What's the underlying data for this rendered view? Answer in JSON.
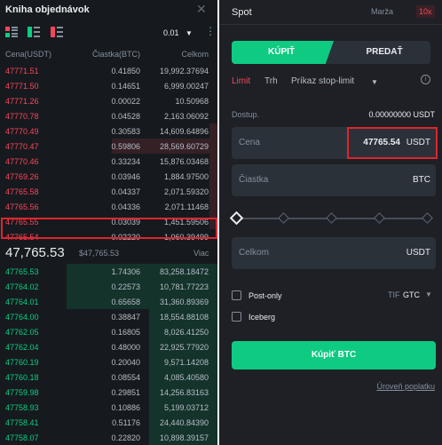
{
  "order_book": {
    "title": "Kniha objednávok",
    "precision": "0.01",
    "columns": {
      "price": "Cena(USDT)",
      "amount": "Čiastka(BTC)",
      "total": "Celkom"
    },
    "asks": [
      {
        "price": "47771.51",
        "amount": "0.41850",
        "total": "19,992.37694",
        "depth": 0
      },
      {
        "price": "47771.50",
        "amount": "0.14651",
        "total": "6,999.00247",
        "depth": 0
      },
      {
        "price": "47771.26",
        "amount": "0.00022",
        "total": "10.50968",
        "depth": 0
      },
      {
        "price": "47770.78",
        "amount": "0.04528",
        "total": "2,163.06092",
        "depth": 0
      },
      {
        "price": "47770.49",
        "amount": "0.30583",
        "total": "14,609.64896",
        "depth": 0.05
      },
      {
        "price": "47770.47",
        "amount": "0.59806",
        "total": "28,569.60729",
        "depth": 0.7
      },
      {
        "price": "47770.46",
        "amount": "0.33234",
        "total": "15,876.03468",
        "depth": 0.05
      },
      {
        "price": "47769.26",
        "amount": "0.03946",
        "total": "1,884.97500",
        "depth": 0.05
      },
      {
        "price": "47765.58",
        "amount": "0.04337",
        "total": "2,071.59320",
        "depth": 0.05
      },
      {
        "price": "47765.56",
        "amount": "0.04336",
        "total": "2,071.11468",
        "depth": 0.05
      },
      {
        "price": "47765.55",
        "amount": "0.03039",
        "total": "1,451.59506",
        "depth": 0.05
      },
      {
        "price": "47765.54",
        "amount": "0.02220",
        "total": "1,060.39499",
        "depth": 0
      }
    ],
    "last_price": "47,765.53",
    "last_price_usd": "$47,765.53",
    "more_label": "Viac",
    "bids": [
      {
        "price": "47765.53",
        "amount": "1.74306",
        "total": "83,258.18472",
        "depth": 1.0
      },
      {
        "price": "47764.02",
        "amount": "0.22573",
        "total": "10,781.77223",
        "depth": 1.0
      },
      {
        "price": "47764.01",
        "amount": "0.65658",
        "total": "31,360.89369",
        "depth": 1.0
      },
      {
        "price": "47764.00",
        "amount": "0.38847",
        "total": "18,554.88108",
        "depth": 0.45
      },
      {
        "price": "47762.05",
        "amount": "0.16805",
        "total": "8,026.41250",
        "depth": 0.45
      },
      {
        "price": "47762.04",
        "amount": "0.48000",
        "total": "22,925.77920",
        "depth": 0.45
      },
      {
        "price": "47760.19",
        "amount": "0.20040",
        "total": "9,571.14208",
        "depth": 0.45
      },
      {
        "price": "47760.18",
        "amount": "0.08554",
        "total": "4,085.40580",
        "depth": 0.45
      },
      {
        "price": "47759.98",
        "amount": "0.29851",
        "total": "14,256.83163",
        "depth": 0.45
      },
      {
        "price": "47758.93",
        "amount": "0.10886",
        "total": "5,199.03712",
        "depth": 0.45
      },
      {
        "price": "47758.41",
        "amount": "0.51176",
        "total": "24,440.84390",
        "depth": 0.45
      },
      {
        "price": "47758.07",
        "amount": "0.22820",
        "total": "10,898.39157",
        "depth": 0.45
      }
    ]
  },
  "trade_panel": {
    "tabs": {
      "spot": "Spot",
      "margin": "Marža",
      "leverage": "10x"
    },
    "buy_label": "KÚPIŤ",
    "sell_label": "PREDAŤ",
    "order_types": {
      "limit": "Limit",
      "market": "Trh",
      "stop_limit": "Príkaz stop-limit"
    },
    "available_label": "Dostup.",
    "available_value": "0.00000000 USDT",
    "price_field": {
      "label": "Cena",
      "value": "47765.54",
      "unit": "USDT"
    },
    "amount_field": {
      "label": "Čiastka",
      "unit": "BTC"
    },
    "total_field": {
      "label": "Celkom",
      "unit": "USDT"
    },
    "slider_percent": 0,
    "post_only_label": "Post-only",
    "iceberg_label": "Iceberg",
    "tif_label": "TIF",
    "tif_value": "GTC",
    "buy_button": "Kúpiť BTC",
    "fee_link": "Úroveň poplatku"
  },
  "colors": {
    "ask": "#f6465d",
    "bid": "#0ecb81",
    "highlight": "#e0242c",
    "accent": "#f0b90b"
  }
}
